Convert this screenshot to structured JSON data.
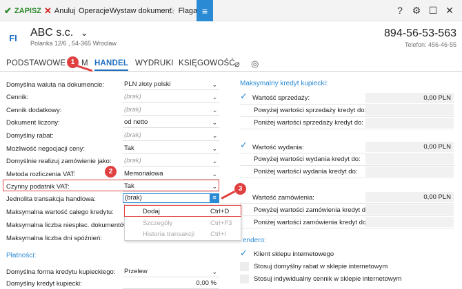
{
  "toolbar": {
    "save_label": "ZAPISZ",
    "cancel_label": "Anuluj",
    "operations_label": "Operacje",
    "issue_label": "Wystaw dokument",
    "flag_label": "Flaga"
  },
  "header": {
    "avatar_initials": "FI",
    "company_name": "ABC s.c.",
    "address": "Polanka  12/6 , 54-365 Wrocław",
    "phone": "894-56-53-563",
    "fax": "Telefon: 456-46-55"
  },
  "tabs": [
    "PODSTAWOWE",
    "M",
    "HANDEL",
    "WYDRUKI",
    "KSIĘGOWOŚĆ"
  ],
  "left_form": {
    "rows": [
      {
        "label": "Domyślna waluta na dokumencie:",
        "value": "PLN złoty polski"
      },
      {
        "label": "Cennik:",
        "value": "(brak)"
      },
      {
        "label": "Cennik dodatkowy:",
        "value": "(brak)"
      },
      {
        "label": "Dokument liczony:",
        "value": "od netto"
      },
      {
        "label": "Domyślny rabat:",
        "value": "(brak)"
      },
      {
        "label": "Możliwość negocjacji ceny:",
        "value": "Tak"
      },
      {
        "label": "Domyślnie realizuj zamówienie jako:",
        "value": "(brak)"
      },
      {
        "label": "Metoda rozliczenia VAT:",
        "value": "Memoriałowa"
      },
      {
        "label": "Czynny podatnik VAT:",
        "value": "Tak"
      }
    ],
    "jt_label": "Jednolita transakcja handlowa:",
    "jt_value": "(brak)",
    "max_value_label": "Maksymalna wartość całego kredytu:",
    "max_unpaid_label": "Maksymalna liczba niespłac. dokumentów",
    "max_delay_label": "Maksymalna liczba dni spóźnień:",
    "payments_title": "Płatności:",
    "credit_form_label": "Domyślna forma kredytu kupieckiego:",
    "credit_form_value": "Przelew",
    "credit_default_label": "Domyślny kredyt kupiecki:",
    "credit_default_value": "0,00 %"
  },
  "popup": {
    "items": [
      {
        "label": "Dodaj",
        "shortcut": "Ctrl+D"
      },
      {
        "label": "Szczegóły",
        "shortcut": "Ctrl+F3"
      },
      {
        "label": "Historia transakcji",
        "shortcut": "Ctrl+I"
      }
    ]
  },
  "right_panel": {
    "title": "Maksymalny kredyt kupiecki:",
    "sales_label": "Wartość sprzedaży:",
    "sales_value": "0,00 PLN",
    "sales_above": "Powyżej wartości sprzedaży kredyt do:",
    "sales_below": "Poniżej wartości sprzedaży kredyt do:",
    "issue_label": "Wartość wydania:",
    "issue_value": "0,00 PLN",
    "issue_above": "Powyżej wartości wydania kredyt do:",
    "issue_below": "Poniżej wartości wydania kredyt do:",
    "order_label": "Wartość zamówienia:",
    "order_value": "0,00 PLN",
    "order_above": "Powyżej wartości zamówienia kredyt do:",
    "order_below": "Poniżej wartości zamówienia kredyt do:",
    "sendero_title": "endero:",
    "shop_client": "Klient sklepu internetowego",
    "shop_discount": "Stosuj domyślny rabat w sklepie internetowym",
    "shop_pricelist": "Stosuj indywidualny cennik w sklepie internetowym"
  },
  "callouts": [
    "1",
    "2",
    "3"
  ],
  "colors": {
    "accent": "#2a8ad4",
    "highlight": "#e04040",
    "save": "#2f8a2f"
  }
}
